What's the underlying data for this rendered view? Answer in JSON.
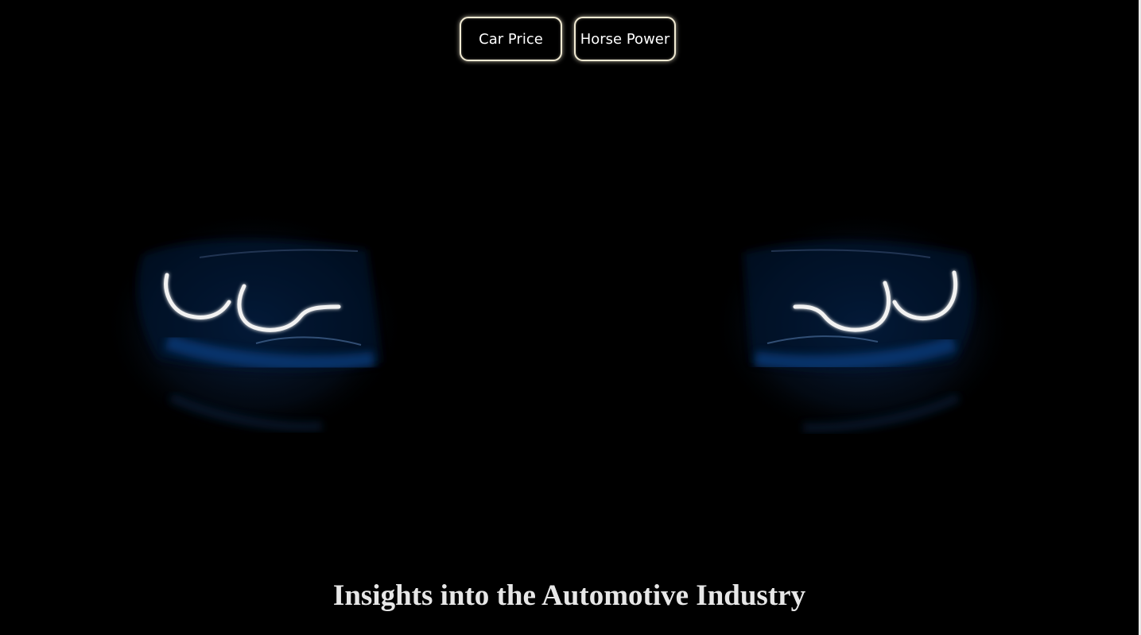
{
  "nav": {
    "buttons": [
      {
        "label": "Car Price"
      },
      {
        "label": "Horse Power"
      }
    ]
  },
  "hero": {
    "image_subject": "car-headlights-in-darkness"
  },
  "page": {
    "title": "Insights into the Automotive Industry"
  },
  "colors": {
    "background": "#000000",
    "button_border": "#f1ead2",
    "headlight_glow": "#ffffff",
    "car_body": "#0b3f7a",
    "title": "#e7e7e7"
  }
}
